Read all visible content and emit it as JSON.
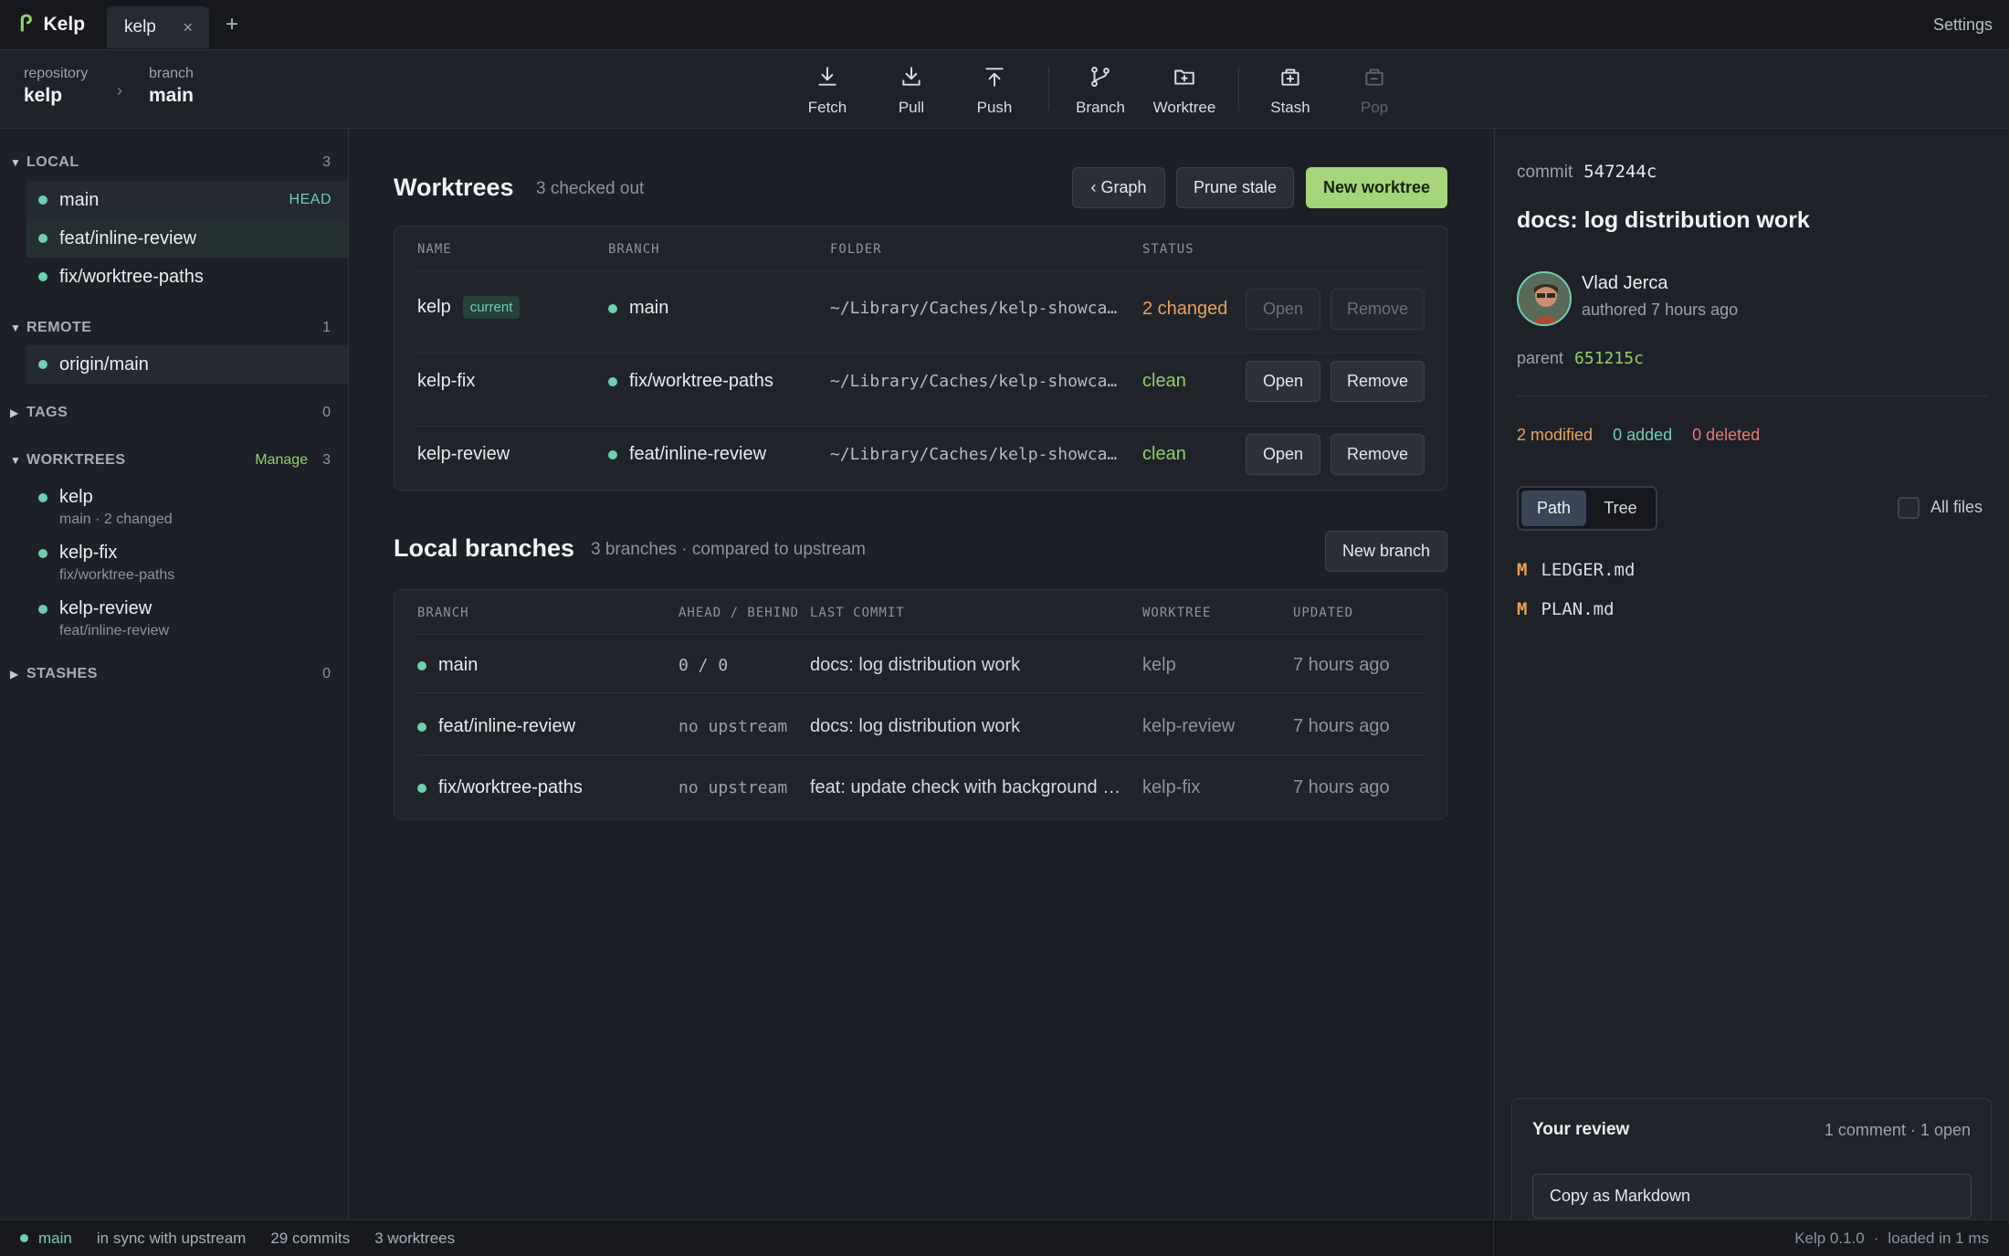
{
  "app": {
    "name": "Kelp",
    "settings_label": "Settings"
  },
  "tabs": [
    {
      "label": "kelp",
      "close": "×"
    }
  ],
  "tab_add": "+",
  "breadcrumb": {
    "repo_caption": "repository",
    "repo": "kelp",
    "branch_caption": "branch",
    "branch": "main",
    "sep": "›"
  },
  "toolbar": {
    "fetch": "Fetch",
    "pull": "Pull",
    "push": "Push",
    "branch": "Branch",
    "worktree": "Worktree",
    "stash": "Stash",
    "pop": "Pop"
  },
  "sidebar": {
    "local": {
      "title": "LOCAL",
      "count": "3",
      "items": [
        {
          "label": "main",
          "tag": "HEAD"
        },
        {
          "label": "feat/inline-review"
        },
        {
          "label": "fix/worktree-paths"
        }
      ]
    },
    "remote": {
      "title": "REMOTE",
      "count": "1",
      "items": [
        {
          "label": "origin/main"
        }
      ]
    },
    "tags": {
      "title": "TAGS",
      "count": "0"
    },
    "worktrees": {
      "title": "WORKTREES",
      "manage": "Manage",
      "count": "3",
      "items": [
        {
          "name": "kelp",
          "sub": "main · 2 changed"
        },
        {
          "name": "kelp-fix",
          "sub": "fix/worktree-paths"
        },
        {
          "name": "kelp-review",
          "sub": "feat/inline-review"
        }
      ]
    },
    "stashes": {
      "title": "STASHES",
      "count": "0"
    }
  },
  "worktrees": {
    "title": "Worktrees",
    "subtitle": "3 checked out",
    "graph_button": "‹ Graph",
    "prune_button": "Prune stale",
    "new_button": "New worktree",
    "columns": {
      "name": "NAME",
      "branch": "BRANCH",
      "folder": "FOLDER",
      "status": "STATUS"
    },
    "rows": [
      {
        "name": "kelp",
        "badge": "current",
        "branch": "main",
        "folder": "~/Library/Caches/kelp-showca…",
        "status": "2 changed",
        "open": "Open",
        "remove": "Remove"
      },
      {
        "name": "kelp-fix",
        "branch": "fix/worktree-paths",
        "folder": "~/Library/Caches/kelp-showca…",
        "status": "clean",
        "open": "Open",
        "remove": "Remove"
      },
      {
        "name": "kelp-review",
        "branch": "feat/inline-review",
        "folder": "~/Library/Caches/kelp-showca…",
        "status": "clean",
        "open": "Open",
        "remove": "Remove"
      }
    ]
  },
  "local_branches": {
    "title": "Local branches",
    "subtitle": "3 branches · compared to upstream",
    "new_button": "New branch",
    "columns": {
      "branch": "BRANCH",
      "ahead": "AHEAD / BEHIND",
      "last_commit": "LAST COMMIT",
      "worktree": "WORKTREE",
      "updated": "UPDATED"
    },
    "rows": [
      {
        "branch": "main",
        "ahead": "0 / 0",
        "last_commit": "docs: log distribution work",
        "worktree": "kelp",
        "updated": "7 hours ago"
      },
      {
        "branch": "feat/inline-review",
        "ahead": "no upstream",
        "last_commit": "docs: log distribution work",
        "worktree": "kelp-review",
        "updated": "7 hours ago"
      },
      {
        "branch": "fix/worktree-paths",
        "ahead": "no upstream",
        "last_commit": "feat: update check with background …",
        "worktree": "kelp-fix",
        "updated": "7 hours ago"
      }
    ]
  },
  "commit": {
    "caption": "commit",
    "hash": "547244c",
    "title": "docs: log distribution work",
    "author": "Vlad Jerca",
    "authored": "authored 7 hours ago",
    "parent_caption": "parent",
    "parent": "651215c",
    "modified": "2 modified",
    "added": "0 added",
    "deleted": "0 deleted",
    "view_path": "Path",
    "view_tree": "Tree",
    "all_files": "All files",
    "files": [
      {
        "status": "M",
        "name": "LEDGER.md"
      },
      {
        "status": "M",
        "name": "PLAN.md"
      }
    ]
  },
  "review": {
    "title": "Your review",
    "meta": "1 comment · 1 open",
    "copy_button": "Copy as Markdown"
  },
  "statusbar": {
    "branch": "main",
    "sync": "in sync with upstream",
    "commits": "29 commits",
    "worktrees": "3 worktrees",
    "version": "Kelp 0.1.0",
    "sep": "·",
    "loaded": "loaded in 1 ms"
  },
  "colors": {
    "accent": "#a6d47a",
    "teal": "#6ecfb2",
    "orange": "#e8a25c",
    "red": "#e47a78",
    "bg": "#1c1f26"
  }
}
